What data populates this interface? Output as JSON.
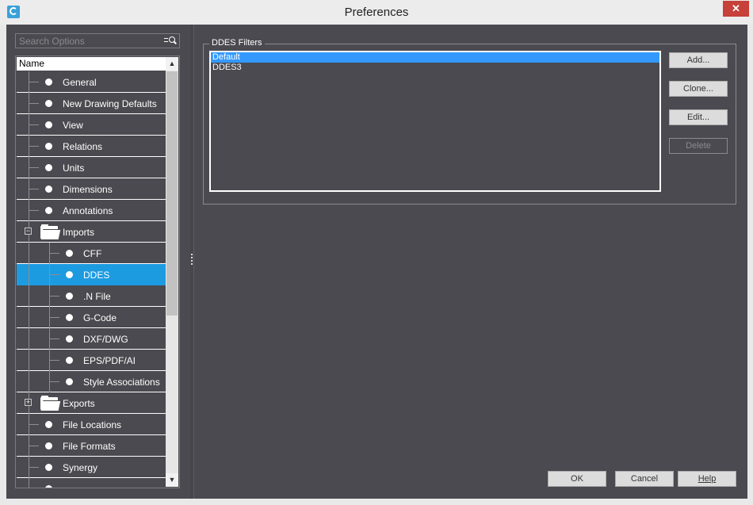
{
  "window": {
    "title": "Preferences",
    "close_glyph": "✕"
  },
  "search": {
    "placeholder": "Search Options",
    "icon": "filter-search-icon"
  },
  "tree": {
    "header": "Name",
    "items": [
      {
        "label": "General",
        "level": 0,
        "kind": "leaf"
      },
      {
        "label": "New Drawing Defaults",
        "level": 0,
        "kind": "leaf"
      },
      {
        "label": "View",
        "level": 0,
        "kind": "leaf"
      },
      {
        "label": "Relations",
        "level": 0,
        "kind": "leaf"
      },
      {
        "label": "Units",
        "level": 0,
        "kind": "leaf"
      },
      {
        "label": "Dimensions",
        "level": 0,
        "kind": "leaf"
      },
      {
        "label": "Annotations",
        "level": 0,
        "kind": "leaf"
      },
      {
        "label": "Imports",
        "level": 0,
        "kind": "folder",
        "expanded": true
      },
      {
        "label": "CFF",
        "level": 1,
        "kind": "leaf"
      },
      {
        "label": "DDES",
        "level": 1,
        "kind": "leaf",
        "selected": true
      },
      {
        "label": ".N File",
        "level": 1,
        "kind": "leaf"
      },
      {
        "label": "G-Code",
        "level": 1,
        "kind": "leaf"
      },
      {
        "label": "DXF/DWG",
        "level": 1,
        "kind": "leaf"
      },
      {
        "label": "EPS/PDF/AI",
        "level": 1,
        "kind": "leaf"
      },
      {
        "label": "Style Associations",
        "level": 1,
        "kind": "leaf"
      },
      {
        "label": "Exports",
        "level": 0,
        "kind": "folder",
        "expanded": false
      },
      {
        "label": "File Locations",
        "level": 0,
        "kind": "leaf"
      },
      {
        "label": "File Formats",
        "level": 0,
        "kind": "leaf"
      },
      {
        "label": "Synergy",
        "level": 0,
        "kind": "leaf"
      },
      {
        "label": "",
        "level": 0,
        "kind": "leaf"
      }
    ]
  },
  "filters": {
    "group_title": "DDES Filters",
    "items": [
      {
        "label": "Default",
        "selected": true
      },
      {
        "label": "DDES3",
        "selected": false
      }
    ]
  },
  "side_buttons": [
    {
      "label": "Add...",
      "enabled": true
    },
    {
      "label": "Clone...",
      "enabled": true
    },
    {
      "label": "Edit...",
      "enabled": true
    },
    {
      "label": "Delete",
      "enabled": false
    }
  ],
  "footer": {
    "ok": "OK",
    "cancel": "Cancel",
    "help": "Help"
  },
  "colors": {
    "panel": "#4a4a50",
    "selection": "#1d9be0",
    "close": "#c7403a"
  }
}
